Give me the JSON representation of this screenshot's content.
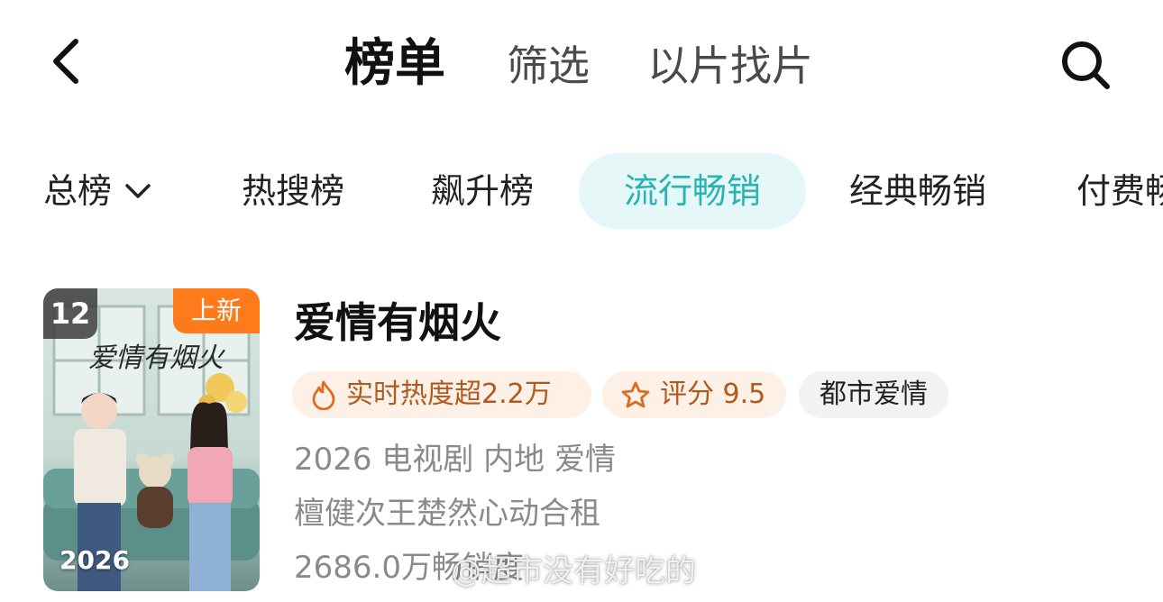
{
  "nav": {
    "back_icon": "chevron-left-icon",
    "tabs": [
      {
        "label": "榜单"
      },
      {
        "label": "筛选"
      },
      {
        "label": "以片找片"
      }
    ],
    "search_icon": "search-icon"
  },
  "chips": [
    {
      "label": "总榜"
    },
    {
      "label": "热搜榜"
    },
    {
      "label": "飙升榜"
    },
    {
      "label": "流行畅销"
    },
    {
      "label": "经典畅销"
    },
    {
      "label": "付费畅"
    }
  ],
  "colors": {
    "accent": "#29b3b3",
    "chip_active_bg": "#e6f7f7",
    "new_badge": "#ff7a1a",
    "tag_warm_bg": "#fdf0e6",
    "tag_warm_text": "#b05a20"
  },
  "item": {
    "rank": "12",
    "new_badge": "上新",
    "poster_year": "2026",
    "poster_title": "爱情有烟火",
    "title": "爱情有烟火",
    "heat_tag": "实时热度超2.2万",
    "score_tag": "评分 9.5",
    "genre_tag": "都市爱情",
    "meta": "2026 电视剧 内地 爱情",
    "description": "檀健次王楚然心动合租",
    "sales": "2686.0万畅销度"
  },
  "watermark": "@超市没有好吃的"
}
